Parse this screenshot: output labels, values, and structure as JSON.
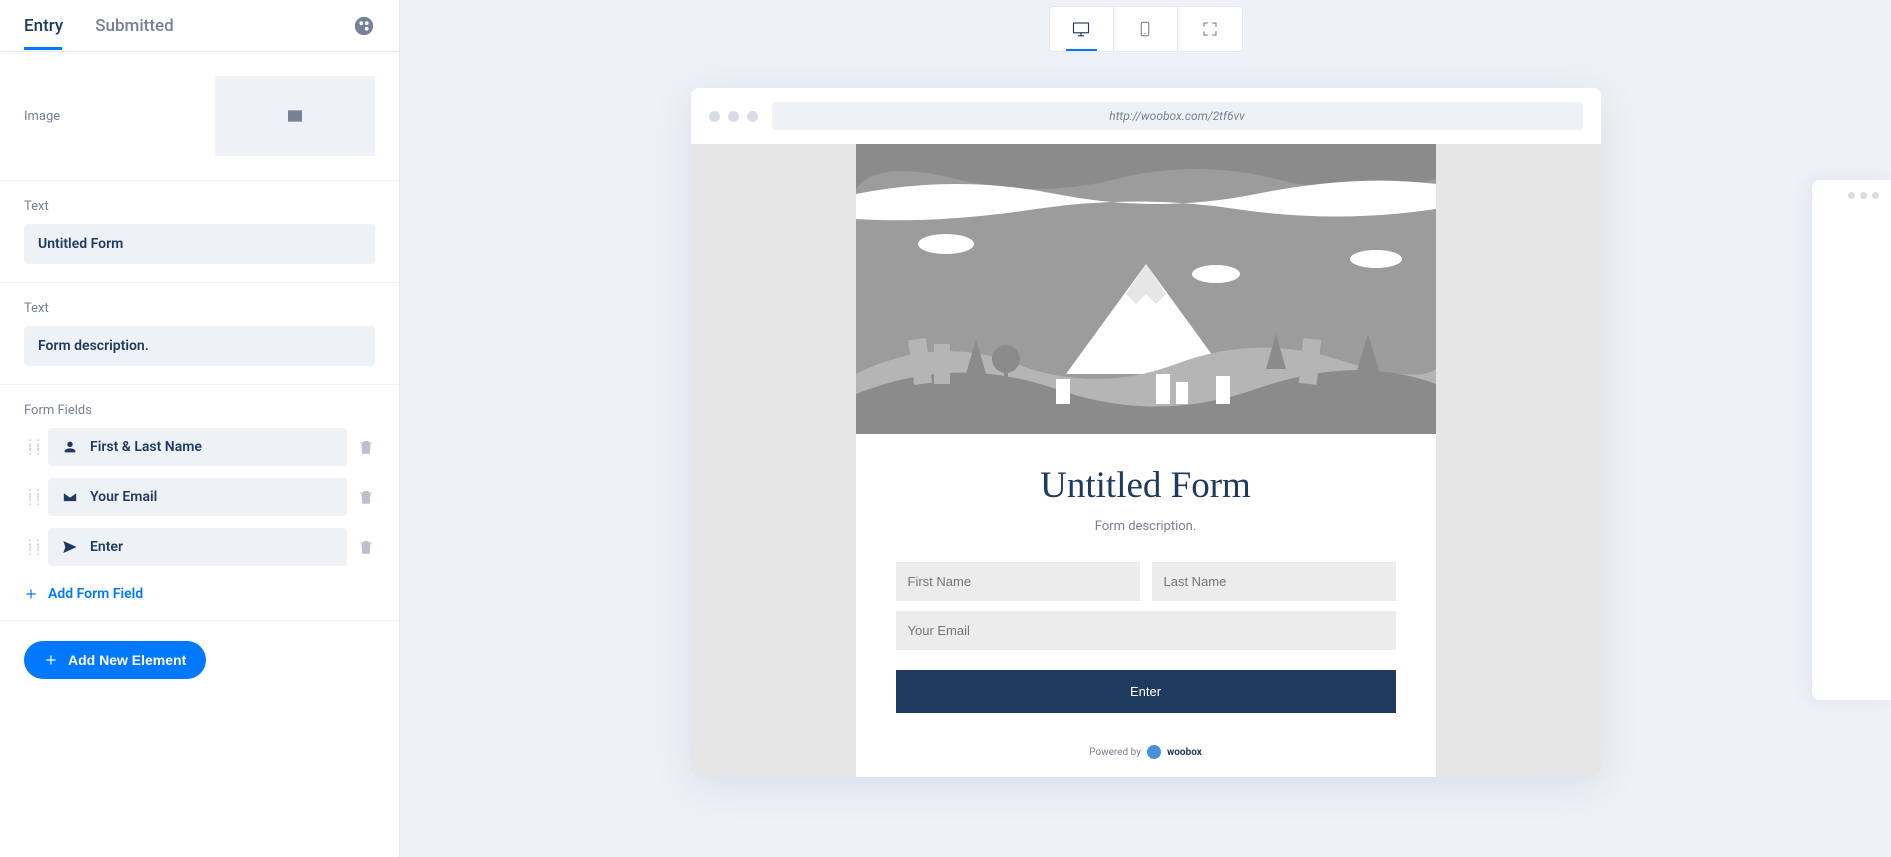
{
  "sidebar": {
    "tabs": {
      "entry": "Entry",
      "submitted": "Submitted"
    },
    "image_label": "Image",
    "text1": {
      "label": "Text",
      "value": "Untitled Form"
    },
    "text2": {
      "label": "Text",
      "value": "Form description."
    },
    "form_fields_label": "Form Fields",
    "fields": [
      "First & Last Name",
      "Your Email",
      "Enter"
    ],
    "add_field": "Add Form Field",
    "add_element": "Add New Element"
  },
  "preview": {
    "url": "http://woobox.com/2tf6vv",
    "title": "Untitled Form",
    "description": "Form description.",
    "first_name_placeholder": "First Name",
    "last_name_placeholder": "Last Name",
    "email_placeholder": "Your Email",
    "submit": "Enter",
    "powered_by_prefix": "Powered by",
    "powered_by_brand": "woobox"
  }
}
